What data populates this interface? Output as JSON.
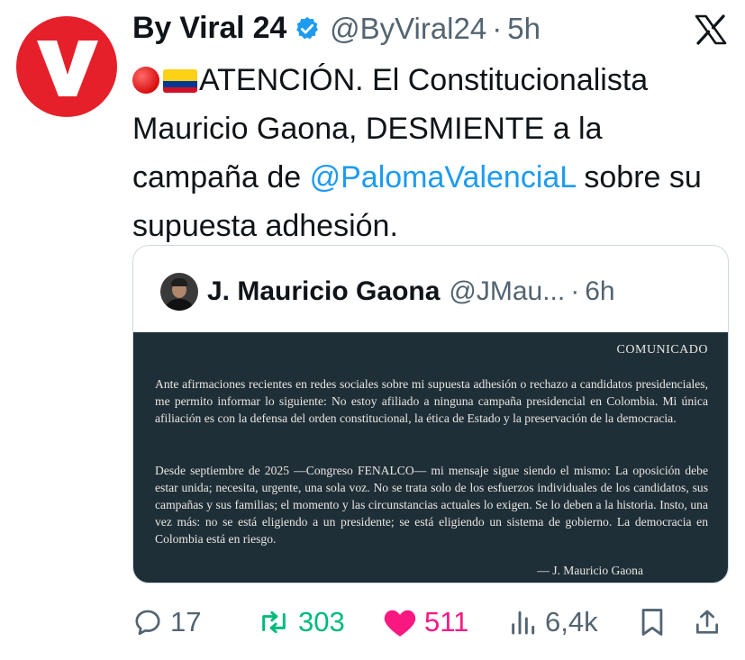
{
  "tweet": {
    "author_name": "By Viral 24",
    "author_handle": "@ByViral24",
    "separator": "·",
    "time": "5h",
    "text_part1": "ATENCIÓN. El Constitucionalista Mauricio Gaona, DESMIENTE a la campaña de ",
    "mention": "@PalomaValenciaL",
    "text_part2": " sobre su supuesta adhesión.",
    "icons": {
      "avatar": "v-logo-icon",
      "verified": "verified-badge-icon",
      "platform": "x-logo-icon",
      "emoji_1": "red-circle-emoji-icon",
      "emoji_2": "colombia-flag-emoji-icon"
    }
  },
  "quoted": {
    "author_name": "J. Mauricio Gaona",
    "author_handle": "@JMau...",
    "separator": "·",
    "time": "6h",
    "statement": {
      "title": "COMUNICADO",
      "paragraph_1": "Ante afirmaciones recientes en redes sociales sobre mi supuesta adhesión o rechazo a candidatos presidenciales, me permito informar lo siguiente: No estoy afiliado a ninguna campaña presidencial en Colombia. Mi única afiliación es con la defensa del orden constitucional, la ética de Estado y la preservación de la democracia.",
      "paragraph_2": "Desde septiembre de 2025 —Congreso FENALCO— mi mensaje sigue siendo el mismo: La oposición debe estar unida; necesita, urgente, una sola voz. No se trata solo de los esfuerzos individuales de los candidatos, sus campañas y sus familias; el momento y las circunstancias actuales lo exigen. Se lo deben a la historia. Insto, una vez más: no se está eligiendo a un presidente; se está eligiendo un sistema de gobierno. La democracia en Colombia está en riesgo.",
      "signature": "— J. Mauricio Gaona"
    }
  },
  "actions": {
    "replies": "17",
    "reposts": "303",
    "likes": "511",
    "views": "6,4k",
    "icons": [
      "reply-icon",
      "repost-icon",
      "like-heart-icon",
      "views-chart-icon",
      "bookmark-icon",
      "share-icon"
    ]
  },
  "colors": {
    "brand_red": "#e5202a",
    "mention_blue": "#1d9bf0",
    "repost_green": "#00ba7c",
    "like_pink": "#f91880",
    "muted_gray": "#536471",
    "statement_bg": "#1f2f38"
  }
}
